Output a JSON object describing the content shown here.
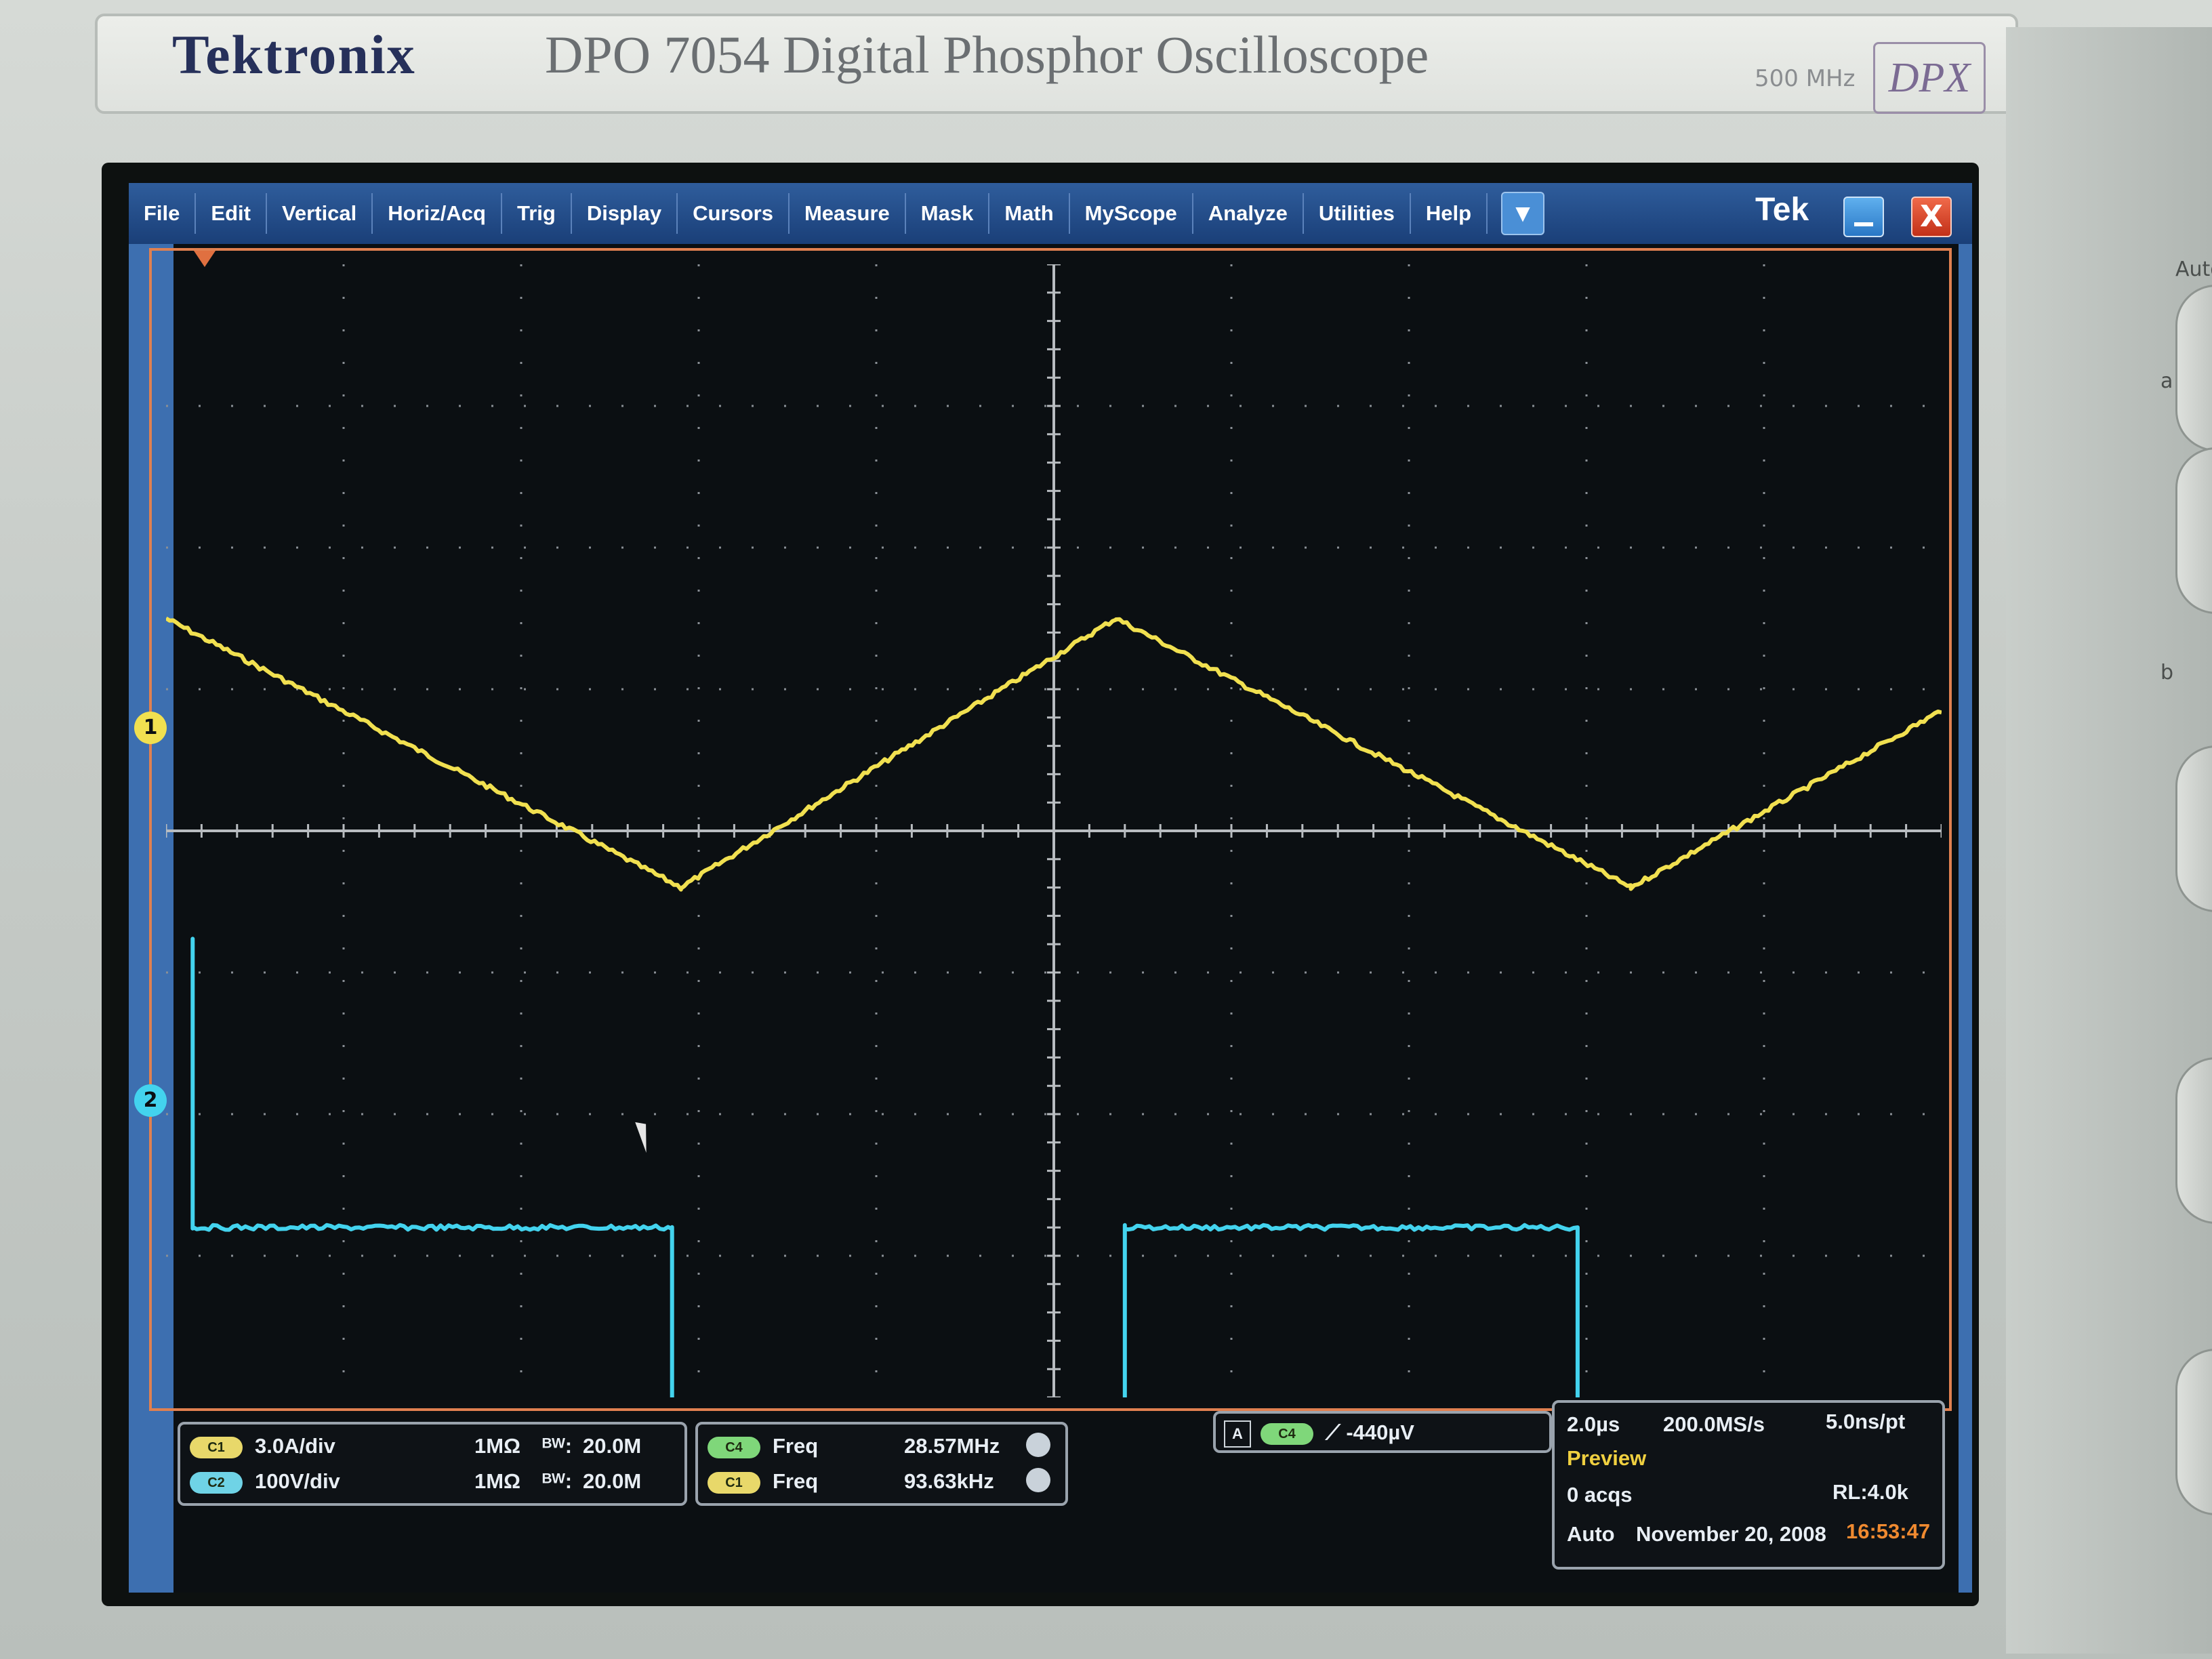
{
  "brand": {
    "logo": "Tektronix",
    "model": "DPO 7054  Digital Phosphor Oscilloscope",
    "bandwidth": "500 MHz",
    "dpx": "DPX"
  },
  "menu": [
    "File",
    "Edit",
    "Vertical",
    "Horiz/Acq",
    "Trig",
    "Display",
    "Cursors",
    "Measure",
    "Mask",
    "Math",
    "MyScope",
    "Analyze",
    "Utilities",
    "Help"
  ],
  "titlebar": {
    "logo": "Tek",
    "close": "X"
  },
  "channels": {
    "ch1": {
      "marker": "1",
      "scale": "3.0A/div",
      "impedance": "1MΩ",
      "bw": "20.0M",
      "color": "#f1e050"
    },
    "ch2": {
      "marker": "2",
      "scale": "100V/div",
      "impedance": "1MΩ",
      "bw": "20.0M",
      "color": "#43d3ee"
    }
  },
  "measurements": [
    {
      "channel": "C4",
      "label": "Freq",
      "value": "28.57MHz"
    },
    {
      "channel": "C1",
      "label": "Freq",
      "value": "93.63kHz"
    }
  ],
  "trigger": {
    "tag": "A",
    "source": "C4",
    "level": "-440µV"
  },
  "acquisition": {
    "time_div": "2.0µs",
    "sample_rate": "200.0MS/s",
    "per_pt": "5.0ns/pt",
    "mode_status": "Preview",
    "acqs": "0 acqs",
    "record_length": "RL:4.0k",
    "trigger_mode": "Auto",
    "date": "November 20, 2008",
    "time": "16:53:47"
  },
  "side_panel": {
    "top_label": "Auto",
    "label_a": "a",
    "label_b": "b"
  },
  "chart_data": {
    "type": "line",
    "x_divisions": 10,
    "y_divisions": 8,
    "series": [
      {
        "name": "C1",
        "color": "#f1e050",
        "x": [
          0.0,
          2.9,
          5.35,
          8.25,
          10.0
        ],
        "y": [
          1.5,
          -0.4,
          1.5,
          -0.4,
          0.85
        ]
      },
      {
        "name": "C2",
        "color": "#43d3ee",
        "x": [
          0.15,
          0.15,
          2.85,
          2.85,
          5.4,
          5.4,
          7.95,
          7.95,
          10.0
        ],
        "y": [
          -0.75,
          -2.8,
          -2.8,
          -4.5,
          -4.5,
          -2.8,
          -2.8,
          -4.45,
          -4.4
        ]
      }
    ]
  }
}
